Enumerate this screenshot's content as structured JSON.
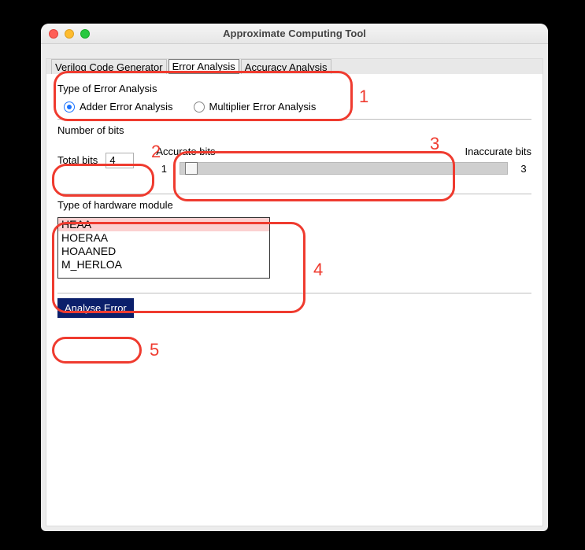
{
  "window": {
    "title": "Approximate Computing Tool"
  },
  "tabs": [
    {
      "label": "Verilog Code Generator",
      "active": false
    },
    {
      "label": "Error Analysis",
      "active": true
    },
    {
      "label": "Accuracy Analysis",
      "active": false
    }
  ],
  "error_analysis": {
    "type_heading": "Type of Error Analysis",
    "options": {
      "adder": "Adder Error Analysis",
      "multiplier": "Multiplier Error Analysis",
      "selected": "adder"
    }
  },
  "bits": {
    "heading": "Number of bits",
    "total_label": "Total bits",
    "total_value": "4",
    "accurate_label": "Accurate bits",
    "inaccurate_label": "Inaccurate bits",
    "accurate_value": "1",
    "inaccurate_value": "3"
  },
  "module": {
    "heading": "Type of hardware module",
    "items": [
      "HEAA",
      "HOERAA",
      "HOAANED",
      "M_HERLOA"
    ],
    "selected_index": 0
  },
  "actions": {
    "analyse_label": "Analyse Error"
  },
  "annotations": {
    "n1": "1",
    "n2": "2",
    "n3": "3",
    "n4": "4",
    "n5": "5"
  }
}
